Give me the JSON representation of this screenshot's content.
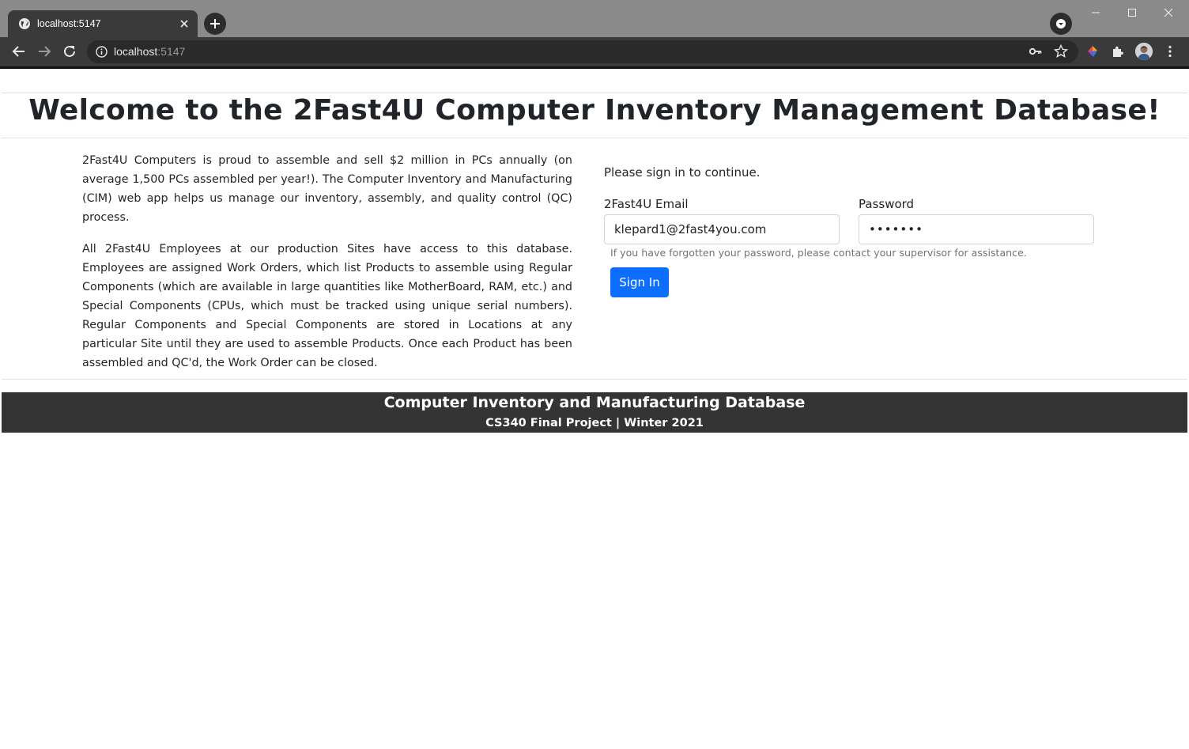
{
  "browser": {
    "tab_title": "localhost:5147",
    "url_host": "localhost",
    "url_port": ":5147",
    "icons": [
      "globe-icon",
      "close-icon",
      "plus-icon",
      "chevron-down-icon",
      "minimize-icon",
      "maximize-icon",
      "close-window-icon",
      "back-icon",
      "forward-icon",
      "reload-icon",
      "info-icon",
      "key-icon",
      "star-icon",
      "extension-icon",
      "puzzle-icon",
      "avatar",
      "more-vert-icon"
    ]
  },
  "header": {
    "title": "Welcome to the 2Fast4U Computer Inventory Management Database!"
  },
  "intro": {
    "paragraph1": "2Fast4U Computers is proud to assemble and sell $2 million in PCs annually (on average 1,500 PCs assembled per year!). The Computer Inventory and Manufacturing (CIM) web app helps us manage our inventory, assembly, and quality control (QC) process.",
    "paragraph2": "All 2Fast4U Employees at our production Sites have access to this database. Employees are assigned Work Orders, which list Products to assemble using Regular Components (which are available in large quantities like MotherBoard, RAM, etc.) and Special Components (CPUs, which must be tracked using unique serial numbers). Regular Components and Special Components are stored in Locations at any particular Site until they are used to assemble Products. Once each Product has been assembled and QC'd, the Work Order can be closed."
  },
  "login": {
    "prompt": "Please sign in to continue.",
    "email_label": "2Fast4U Email",
    "email_value": "klepard1@2fast4you.com",
    "password_label": "Password",
    "password_value": "•••••••",
    "help_text": "If you have forgotten your password, please contact your supervisor for assistance.",
    "submit_label": "Sign In"
  },
  "footer": {
    "line1": "Computer Inventory and Manufacturing Database",
    "line2": "CS340 Final Project | Winter 2021"
  },
  "colors": {
    "primary": "#0d6efd",
    "footer_bg": "#343434",
    "text": "#212529",
    "muted": "#6c757d"
  }
}
